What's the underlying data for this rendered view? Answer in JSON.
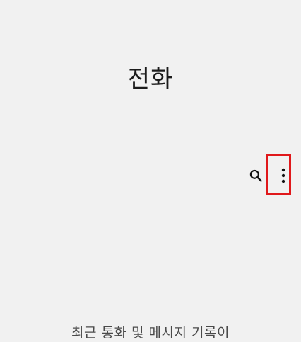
{
  "header": {
    "title": "전화"
  },
  "toolbar": {
    "search_icon": "search-icon",
    "more_icon": "more-vert-icon"
  },
  "highlight": {
    "color": "#e0181b"
  },
  "main": {
    "empty_message": "최근 통화 및 메시지 기록이"
  }
}
